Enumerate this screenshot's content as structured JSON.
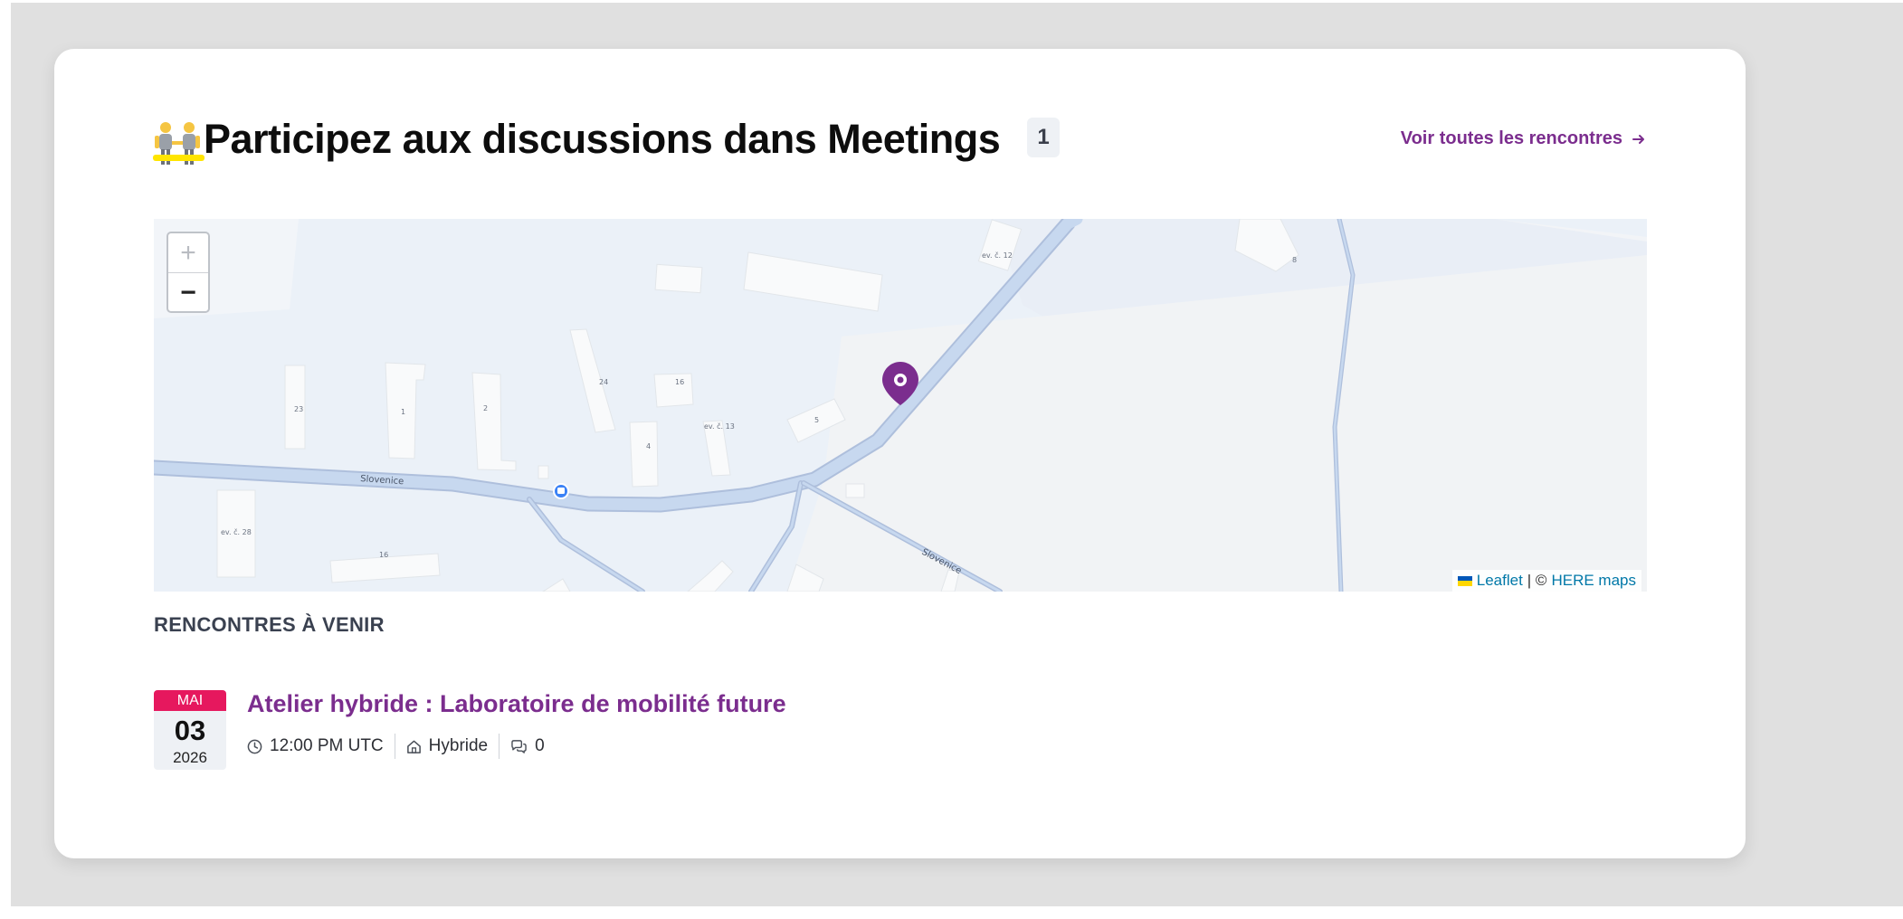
{
  "section": {
    "title": "Participez aux discussions dans Meetings",
    "count": "1",
    "see_all_label": "Voir toutes les rencontres"
  },
  "map": {
    "zoom_in_label": "+",
    "zoom_out_label": "−",
    "attribution": {
      "leaflet_label": "Leaflet",
      "separator": "| ©",
      "provider_label": "HERE maps"
    },
    "street_labels": [
      "Slovenice",
      "Slovenice"
    ],
    "building_labels": [
      "ev. č. 12",
      "8",
      "23",
      "1",
      "2",
      "24",
      "16",
      "ev. č. 13",
      "5",
      "4",
      "ev. č. 28",
      "16"
    ]
  },
  "upcoming": {
    "heading": "RENCONTRES À VENIR",
    "meetings": [
      {
        "month": "MAI",
        "day": "03",
        "year": "2026",
        "title": "Atelier hybride : Laboratoire de mobilité future",
        "time": "12:00 PM UTC",
        "type": "Hybride",
        "comments": "0"
      }
    ]
  },
  "colors": {
    "accent": "#7b2d8e",
    "month_badge": "#e6185e",
    "title_underline": "#ffe500",
    "road": "#c7d8ef",
    "map_block": "#ebf1f8"
  },
  "icons": {
    "people": "people-holding-hands-icon",
    "arrow": "arrow-right-icon",
    "marker": "map-marker-icon",
    "bus": "bus-stop-icon",
    "clock": "clock-icon",
    "home": "home-icon",
    "comments": "comments-icon"
  }
}
